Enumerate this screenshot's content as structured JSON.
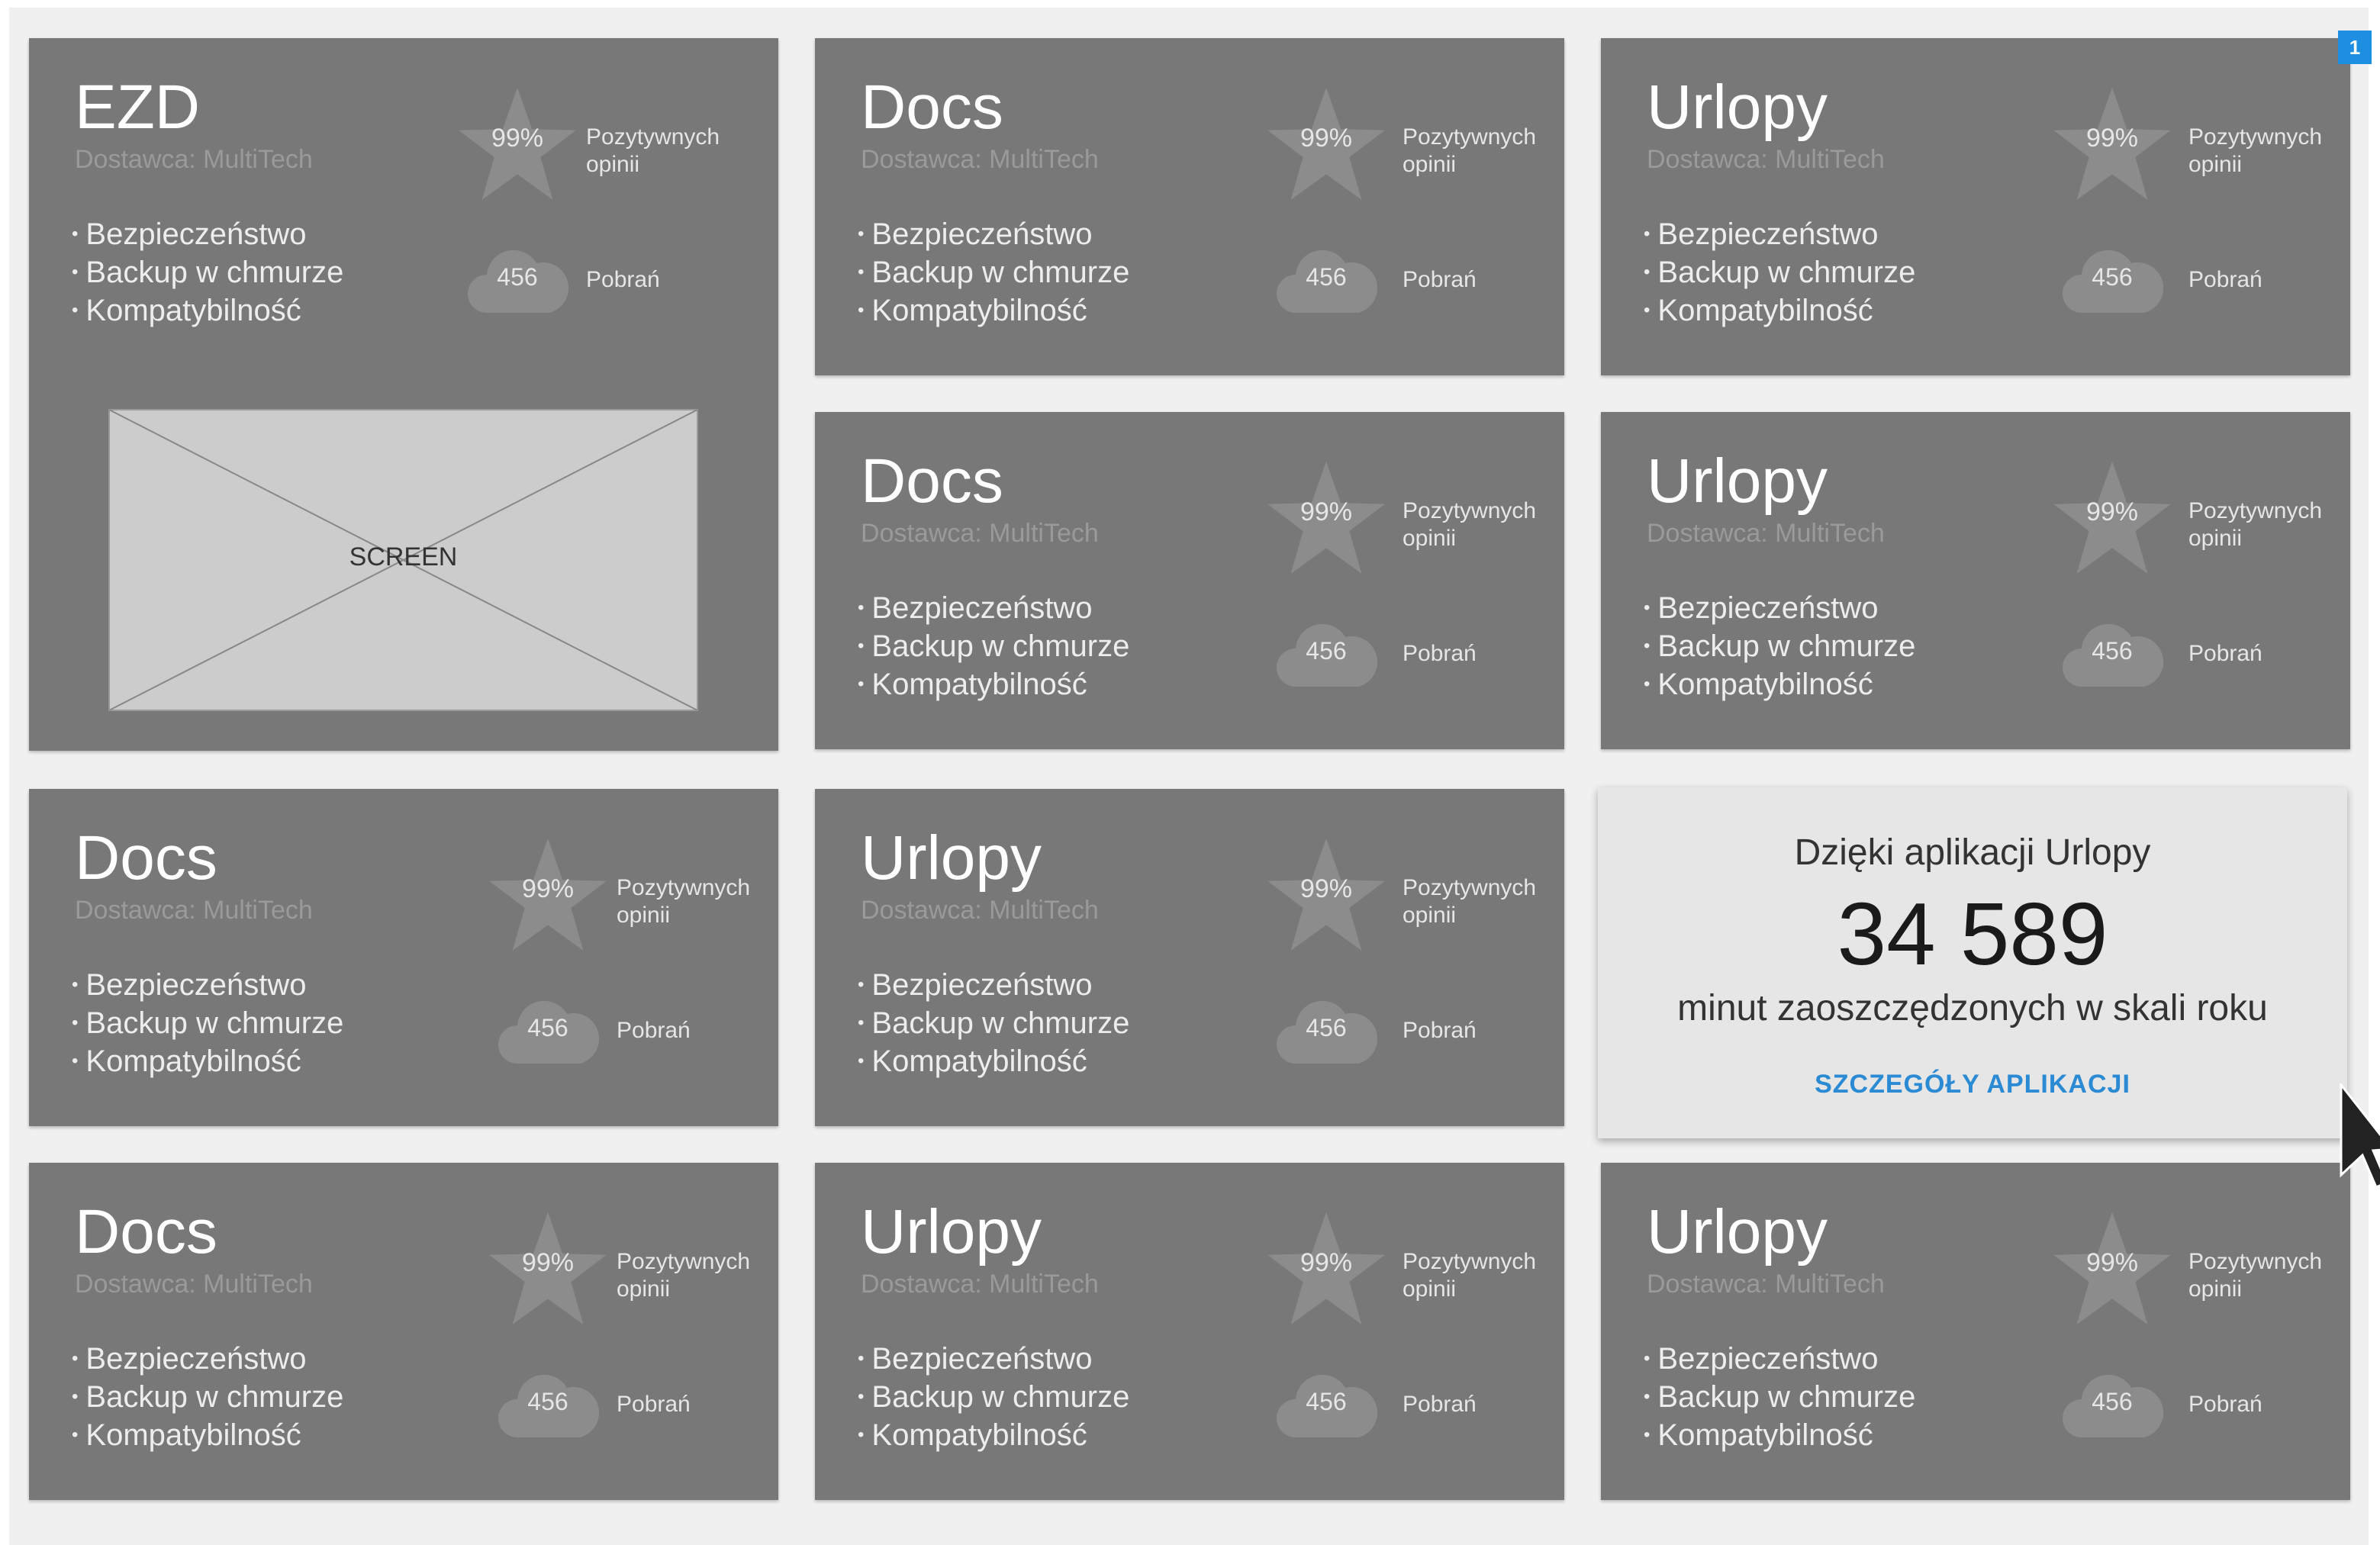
{
  "cards": [
    {
      "title": "EZD",
      "vendor": "Dostawca: MultiTech",
      "features": [
        "Bezpieczeństwo",
        "Backup w chmurze",
        "Kompatybilność"
      ],
      "rating": "99%",
      "rating_label": "Pozytywnych opinii",
      "downloads": "456",
      "downloads_label": "Pobrań"
    },
    {
      "title": "Docs",
      "vendor": "Dostawca: MultiTech",
      "features": [
        "Bezpieczeństwo",
        "Backup w chmurze",
        "Kompatybilność"
      ],
      "rating": "99%",
      "rating_label": "Pozytywnych opinii",
      "downloads": "456",
      "downloads_label": "Pobrań"
    },
    {
      "title": "Urlopy",
      "vendor": "Dostawca: MultiTech",
      "features": [
        "Bezpieczeństwo",
        "Backup w chmurze",
        "Kompatybilność"
      ],
      "rating": "99%",
      "rating_label": "Pozytywnych opinii",
      "downloads": "456",
      "downloads_label": "Pobrań"
    },
    {
      "title": "Docs",
      "vendor": "Dostawca: MultiTech",
      "features": [
        "Bezpieczeństwo",
        "Backup w chmurze",
        "Kompatybilność"
      ],
      "rating": "99%",
      "rating_label": "Pozytywnych opinii",
      "downloads": "456",
      "downloads_label": "Pobrań"
    },
    {
      "title": "Urlopy",
      "vendor": "Dostawca: MultiTech",
      "features": [
        "Bezpieczeństwo",
        "Backup w chmurze",
        "Kompatybilność"
      ],
      "rating": "99%",
      "rating_label": "Pozytywnych opinii",
      "downloads": "456",
      "downloads_label": "Pobrań"
    },
    {
      "title": "Docs",
      "vendor": "Dostawca: MultiTech",
      "features": [
        "Bezpieczeństwo",
        "Backup w chmurze",
        "Kompatybilność"
      ],
      "rating": "99%",
      "rating_label": "Pozytywnych opinii",
      "downloads": "456",
      "downloads_label": "Pobrań"
    },
    {
      "title": "Urlopy",
      "vendor": "Dostawca: MultiTech",
      "features": [
        "Bezpieczeństwo",
        "Backup w chmurze",
        "Kompatybilność"
      ],
      "rating": "99%",
      "rating_label": "Pozytywnych opinii",
      "downloads": "456",
      "downloads_label": "Pobrań"
    },
    {
      "title": "Docs",
      "vendor": "Dostawca: MultiTech",
      "features": [
        "Bezpieczeństwo",
        "Backup w chmurze",
        "Kompatybilność"
      ],
      "rating": "99%",
      "rating_label": "Pozytywnych opinii",
      "downloads": "456",
      "downloads_label": "Pobrań"
    },
    {
      "title": "Urlopy",
      "vendor": "Dostawca: MultiTech",
      "features": [
        "Bezpieczeństwo",
        "Backup w chmurze",
        "Kompatybilność"
      ],
      "rating": "99%",
      "rating_label": "Pozytywnych opinii",
      "downloads": "456",
      "downloads_label": "Pobrań"
    },
    {
      "title": "Urlopy",
      "vendor": "Dostawca: MultiTech",
      "features": [
        "Bezpieczeństwo",
        "Backup w chmurze",
        "Kompatybilność"
      ],
      "rating": "99%",
      "rating_label": "Pozytywnych opinii",
      "downloads": "456",
      "downloads_label": "Pobrań"
    }
  ],
  "screen_placeholder": {
    "label": "SCREEN"
  },
  "highlight": {
    "intro": "Dzięki aplikacji Urlopy",
    "value": "34 589",
    "caption": "minut zaoszczędzonych w skali roku",
    "link": "SZCZEGÓŁY APLIKACJI"
  },
  "badge": "1",
  "colors": {
    "card_bg": "#787878",
    "page_bg": "#f0f0f0",
    "link": "#2a8ad4",
    "badge": "#1e8fe0"
  }
}
